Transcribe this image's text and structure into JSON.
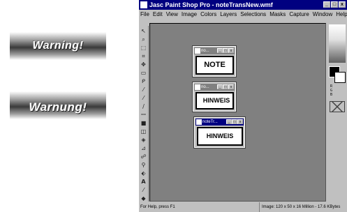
{
  "banners": [
    {
      "text": "Warning!"
    },
    {
      "text": "Warnung!"
    }
  ],
  "app": {
    "title": "Jasc Paint Shop Pro - noteTransNew.wmf",
    "window_buttons": {
      "minimize": "_",
      "maximize": "□",
      "close": "x"
    },
    "menu": [
      "File",
      "Edit",
      "View",
      "Image",
      "Colors",
      "Layers",
      "Selections",
      "Masks",
      "Capture",
      "Window",
      "Help"
    ],
    "tools": [
      "arrow-icon",
      "zoom-icon",
      "deform-icon",
      "crop-icon",
      "mover-icon",
      "selection-icon",
      "freehand-icon",
      "eyedropper-icon",
      "paintbrush-icon",
      "clone-icon",
      "color-replacer-icon",
      "retouch-icon",
      "scratch-remover-icon",
      "eraser-icon",
      "picture-tube-icon",
      "airbrush-icon",
      "flood-fill-icon",
      "text-icon",
      "draw-icon",
      "preset-shapes-icon",
      "object-selector-icon"
    ]
  },
  "doc_windows": [
    {
      "title": "no...",
      "content": "NOTE",
      "active": false
    },
    {
      "title": "no...",
      "content": "HINWEIS",
      "active": false
    },
    {
      "title": "noteTr...",
      "content": "HINWEIS",
      "active": true
    }
  ],
  "right_panel": {
    "labels": [
      "R",
      "G",
      "B"
    ]
  },
  "status": {
    "help": "For Help, press F1",
    "image_info": "Image: 120 x 50 x 16 Million - 17.6 KBytes"
  },
  "colors": {
    "titlebar": "#000080",
    "workspace": "#808080",
    "chrome": "#c0c0c0"
  }
}
